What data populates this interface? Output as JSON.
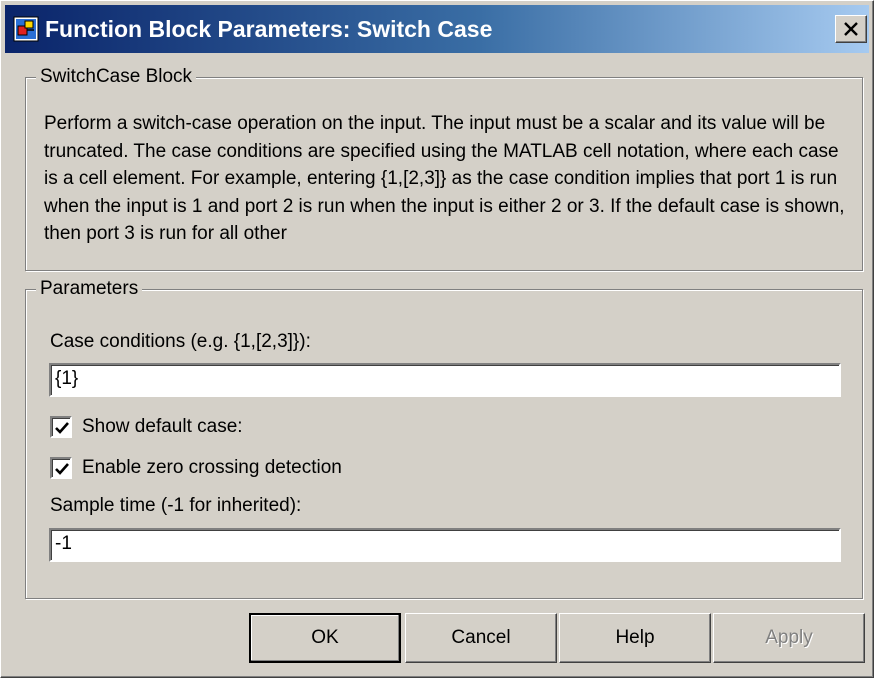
{
  "window": {
    "title": "Function Block Parameters: Switch Case"
  },
  "block_group": {
    "legend": "SwitchCase Block",
    "description": "Perform a switch-case operation on the input.  The input must be a scalar and its value will be truncated.  The case conditions are specified using the MATLAB cell notation, where each case is a cell element.  For example, entering {1,[2,3]} as the case condition implies that port 1 is run when the input is 1 and port 2 is run when the input is either 2 or 3.  If the default case is shown, then port 3 is run for all other"
  },
  "parameters": {
    "legend": "Parameters",
    "case_conditions_label": "Case conditions (e.g. {1,[2,3]}):",
    "case_conditions_value": "{1}",
    "show_default_label": "Show default case:",
    "show_default_checked": true,
    "zero_crossing_label": "Enable zero crossing detection",
    "zero_crossing_checked": true,
    "sample_time_label": "Sample time (-1 for inherited):",
    "sample_time_value": "-1"
  },
  "buttons": {
    "ok": "OK",
    "cancel": "Cancel",
    "help": "Help",
    "apply": "Apply"
  },
  "colors": {
    "titlebar_start": "#0a246a",
    "titlebar_end": "#a6caf0",
    "dialog_bg": "#d4d0c8"
  },
  "icons": {
    "window_icon": "simulink-block-icon",
    "close": "close-icon",
    "check": "check-icon"
  }
}
